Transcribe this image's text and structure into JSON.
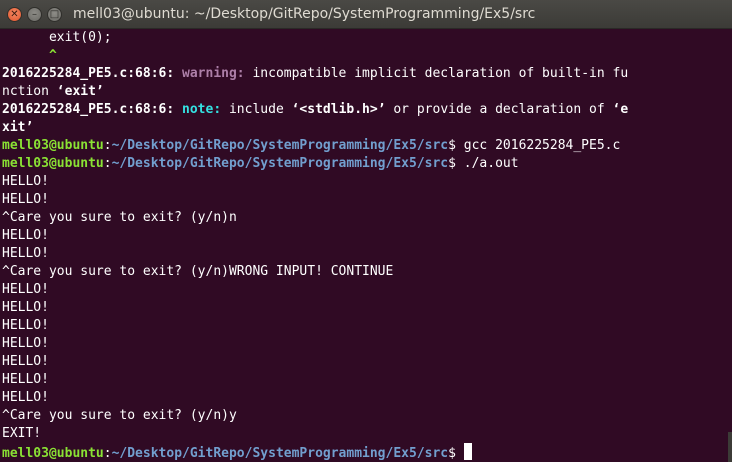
{
  "window": {
    "title": "mell03@ubuntu: ~/Desktop/GitRepo/SystemProgramming/Ex5/src",
    "close_glyph": "✕",
    "minimize_glyph": "–",
    "maximize_glyph": "□"
  },
  "colors": {
    "background": "#300a24",
    "prompt_user": "#8ae234",
    "prompt_path": "#729fcf",
    "warning": "#ad7fa8",
    "note": "#34e2e2"
  },
  "terminal": {
    "lines": {
      "l0": "      exit(0);",
      "l1": "      ^",
      "l2_loc": "2016225284_PE5.c:68:6: ",
      "l2_kind": "warning: ",
      "l2_msg": "incompatible implicit declaration of built-in fu",
      "l3_a": "nction ",
      "l3_b": "‘exit’",
      "l4_loc": "2016225284_PE5.c:68:6: ",
      "l4_kind": "note: ",
      "l4_a": "include ",
      "l4_b": "‘<stdlib.h>’",
      "l4_c": " or provide a declaration of ",
      "l4_d": "‘e",
      "l5": "xit’",
      "l6_user": "mell03@ubuntu",
      "l6_sep": ":",
      "l6_path": "~/Desktop/GitRepo/SystemProgramming/Ex5/src",
      "l6_cmd": "$ gcc 2016225284_PE5.c",
      "l7_user": "mell03@ubuntu",
      "l7_sep": ":",
      "l7_path": "~/Desktop/GitRepo/SystemProgramming/Ex5/src",
      "l7_cmd": "$ ./a.out",
      "l8": "HELLO!",
      "l9": "HELLO!",
      "l10": "^Care you sure to exit? (y/n)n",
      "l11": "HELLO!",
      "l12": "HELLO!",
      "l13": "^Care you sure to exit? (y/n)WRONG INPUT! CONTINUE",
      "l14": "HELLO!",
      "l15": "HELLO!",
      "l16": "HELLO!",
      "l17": "HELLO!",
      "l18": "HELLO!",
      "l19": "HELLO!",
      "l20": "HELLO!",
      "l21": "^Care you sure to exit? (y/n)y",
      "l22": "EXIT!",
      "l23_user": "mell03@ubuntu",
      "l23_sep": ":",
      "l23_path": "~/Desktop/GitRepo/SystemProgramming/Ex5/src",
      "l23_cmd": "$ "
    }
  }
}
